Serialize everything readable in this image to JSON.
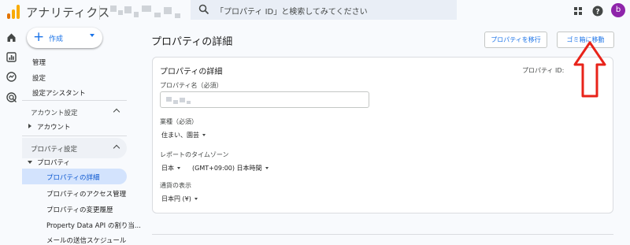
{
  "app": {
    "title": "アナリティクス"
  },
  "search": {
    "placeholder": "「プロパティ ID」と検索してみてください"
  },
  "user": {
    "avatar_letter": "b"
  },
  "colors": {
    "accent": "#1a73e8",
    "active_bg": "#d3e3fd",
    "avatar": "#8e24aa",
    "annotation": "#e8231a"
  },
  "rail": {
    "icons": [
      "home-icon",
      "reports-icon",
      "explore-icon",
      "advertising-icon"
    ]
  },
  "sidebar": {
    "create_label": "作成",
    "top_items": [
      "管理",
      "設定",
      "設定アシスタント"
    ],
    "account_section": {
      "title": "アカウント設定",
      "items": [
        "アカウント"
      ]
    },
    "property_section": {
      "title": "プロパティ設定",
      "group": "プロパティ",
      "items": [
        "プロパティの詳細",
        "プロパティのアクセス管理",
        "プロパティの変更履歴",
        "Property Data API の割り当...",
        "メールの送信スケジュール"
      ],
      "active_index": 0
    }
  },
  "main": {
    "page_title": "プロパティの詳細",
    "move_button": "プロパティを移行",
    "trash_button": "ゴミ箱に移動",
    "card": {
      "title": "プロパティの詳細",
      "property_id_label": "プロパティ ID:",
      "name_label": "プロパティ名（必須）",
      "industry_label": "業種（必須）",
      "industry_value": "住まい、園芸",
      "timezone_label": "レポートのタイムゾーン",
      "timezone_country": "日本",
      "timezone_value": "(GMT+09:00) 日本時間",
      "currency_label": "通貨の表示",
      "currency_value": "日本円 (¥)"
    }
  }
}
